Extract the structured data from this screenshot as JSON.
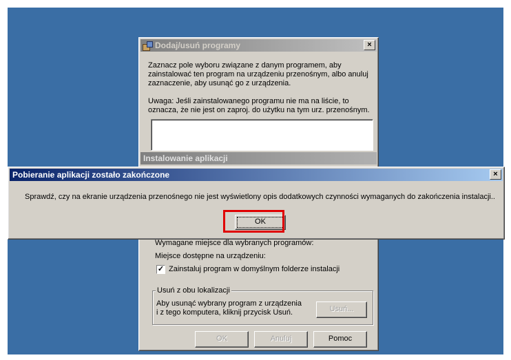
{
  "background_window": {
    "title": "Dodaj/usuń programy",
    "close_label": "×",
    "instructions": "Zaznacz pole wyboru związane z danym programem, aby zainstalować ten program na urządzeniu przenośnym, albo anuluj zaznaczenie, aby usunąć go z urządzenia.",
    "warning_line1": "Uwaga: Jeśli zainstalowanego programu nie ma na liście, to",
    "warning_line2": "oznacza, że nie jest on zaproj. do użytku na tym urz. przenośnym.",
    "installing_banner": "Instalowanie aplikacji",
    "required_space": "Wymagane miejsce dla wybranych programów:",
    "available_space": "Miejsce dostępne na urządzeniu:",
    "install_default_checked": true,
    "install_default_label": "Zainstaluj program w domyślnym folderze instalacji",
    "remove_group_label": "Usuń z obu lokalizacji",
    "remove_text_line1": "Aby usunąć wybrany program z urządzenia",
    "remove_text_line2": "i z tego komputera, kliknij przycisk Usuń.",
    "remove_button": "Usuń...",
    "ok_button": "OK",
    "cancel_button": "Anuluj",
    "help_button": "Pomoc"
  },
  "dialog": {
    "title": "Pobieranie aplikacji zostało zakończone",
    "close_label": "×",
    "message": "Sprawdź, czy na ekranie urządzenia przenośnego nie jest wyświetlony opis dodatkowych czynności wymaganych do zakończenia instalacji..",
    "ok_button": "OK",
    "highlight_color": "#e00000"
  },
  "colors": {
    "desktop": "#3a6ea5",
    "window_face": "#d4d0c8",
    "active_title": "#0a246a"
  }
}
